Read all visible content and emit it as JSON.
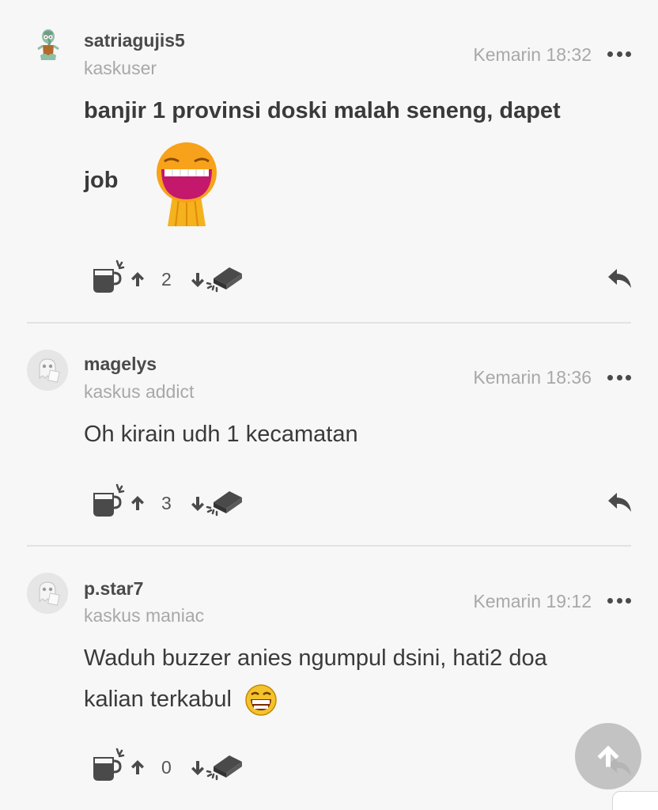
{
  "posts": [
    {
      "username": "satriagujis5",
      "rank": "kaskuser",
      "timestamp": "Kemarin 18:32",
      "content_lines": [
        "banjir 1 provinsi doski malah seneng, dapet",
        "job"
      ],
      "votes": "2",
      "avatar": "squidward-avatar"
    },
    {
      "username": "magelys",
      "rank": "kaskus addict",
      "timestamp": "Kemarin 18:36",
      "content_lines": [
        "Oh kirain udh 1 kecamatan"
      ],
      "votes": "3",
      "avatar": "default-ghost-avatar"
    },
    {
      "username": "p.star7",
      "rank": "kaskus maniac",
      "timestamp": "Kemarin 19:12",
      "content_lines": [
        "Waduh buzzer anies ngumpul dsini, hati2 doa",
        "kalian terkabul"
      ],
      "votes": "0",
      "avatar": "default-ghost-avatar"
    }
  ],
  "icons": {
    "cendol": "cendol-cup-icon",
    "upvote": "arrow-up-icon",
    "downvote": "arrow-down-icon",
    "bata": "brick-icon",
    "reply": "reply-icon",
    "more": "more-dots-icon",
    "scroll_top": "scroll-to-top-icon"
  },
  "colors": {
    "background": "#f7f7f7",
    "text": "#3a3a3a",
    "muted": "#a8a8a8",
    "icon": "#4a4a4a",
    "divider": "#e2e2e2"
  }
}
